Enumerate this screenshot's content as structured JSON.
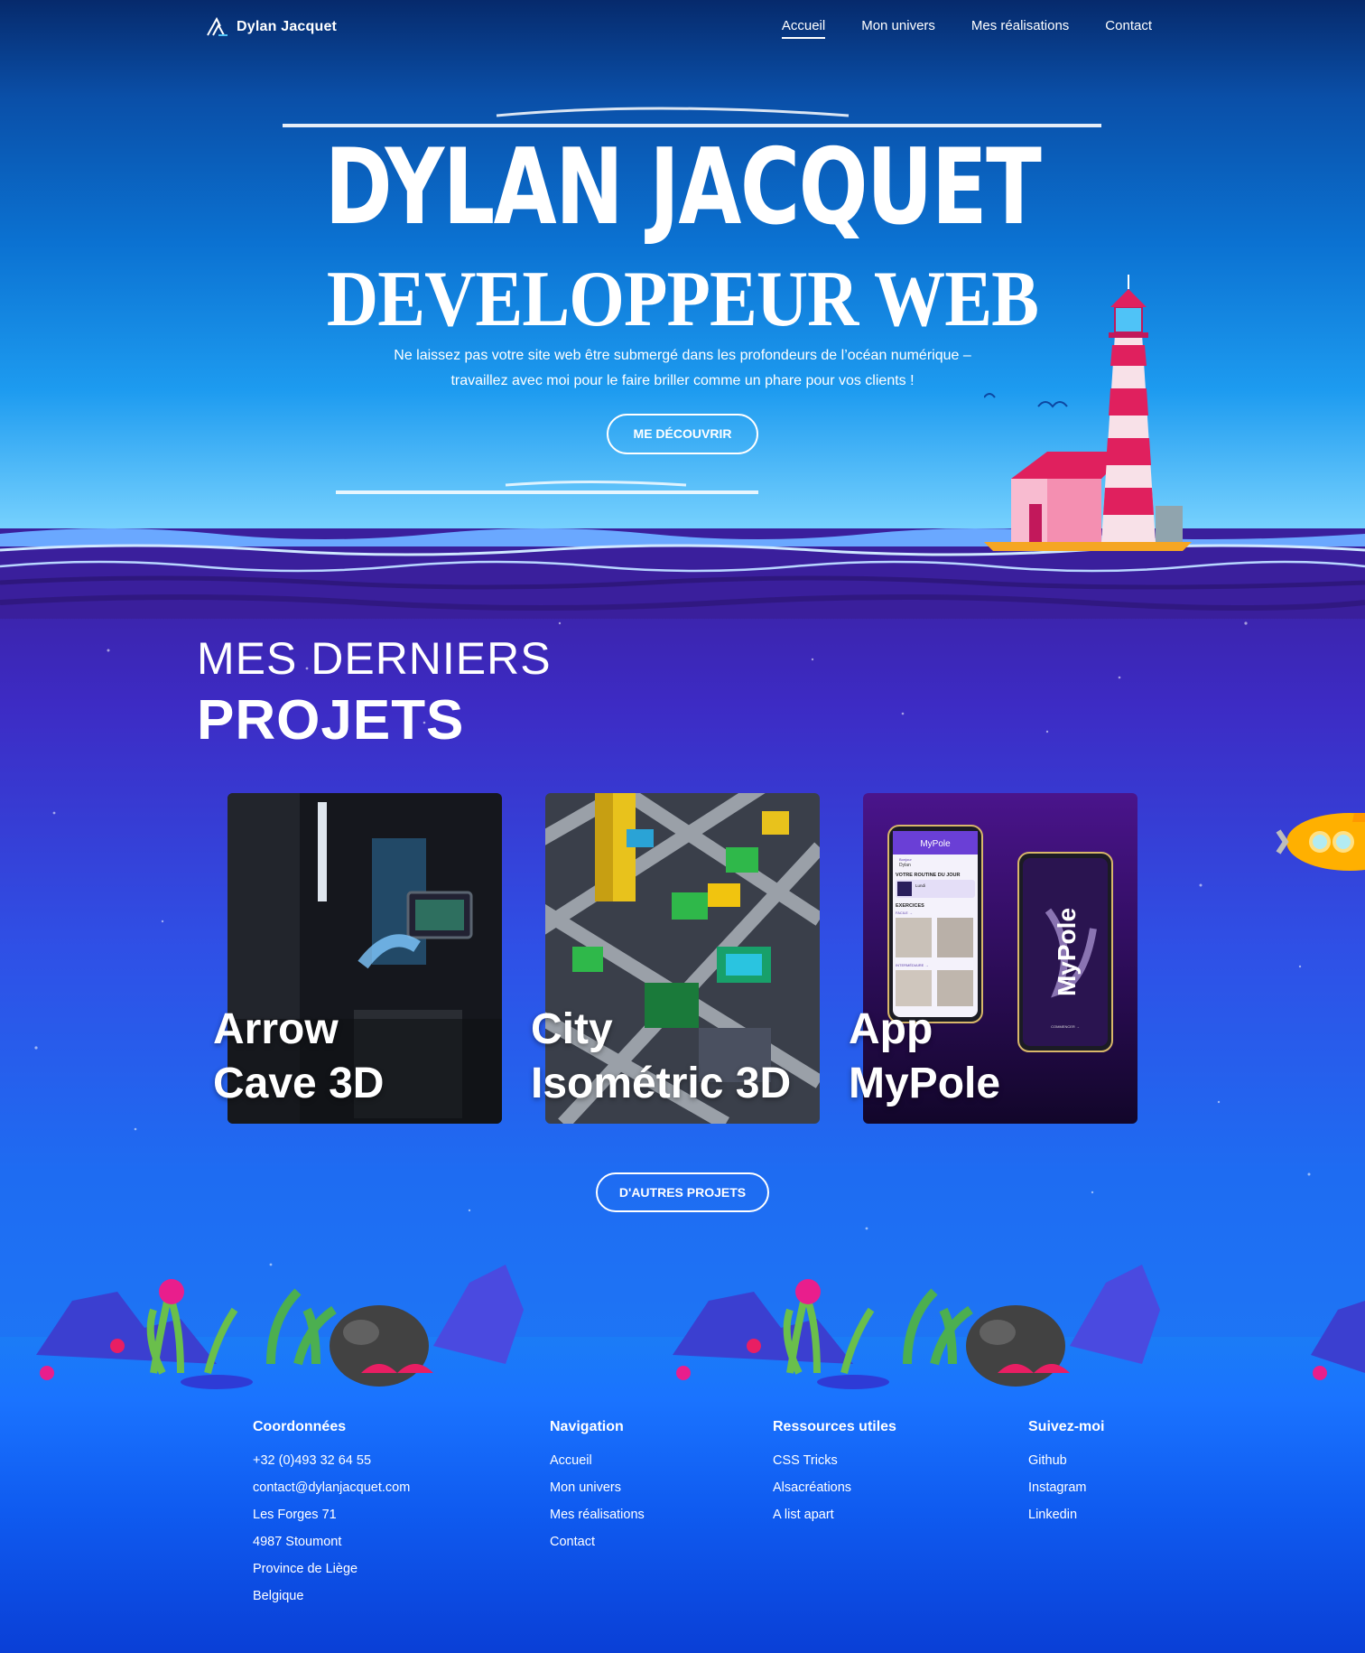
{
  "header": {
    "brand": "Dylan Jacquet",
    "nav": [
      "Accueil",
      "Mon univers",
      "Mes réalisations",
      "Contact"
    ],
    "active_nav": "Accueil"
  },
  "hero": {
    "title": "DYLAN JACQUET",
    "subtitle": "DEVELOPPEUR WEB",
    "text_line1": "Ne laissez pas votre site web être submergé dans les profondeurs de l’océan numérique –",
    "text_line2": "travaillez avec moi pour le faire briller comme un phare pour vos clients !",
    "cta": "ME DÉCOUVRIR"
  },
  "projects": {
    "kicker": "MES DERNIERS",
    "title": "PROJETS",
    "cards": [
      {
        "line1": "Arrow",
        "line2": "Cave 3D"
      },
      {
        "line1": "City",
        "line2": "Isométric 3D"
      },
      {
        "line1": "App",
        "line2": "MyPole"
      }
    ],
    "mockup": {
      "app_name": "MyPole",
      "greeting_small": "Bonjour",
      "greeting_name": "Dylan",
      "routine": "VOTRE ROUTINE DU JOUR",
      "routine_day": "Lundi",
      "exercises": "EXERCICES",
      "level_easy": "FACILE →",
      "level_mid": "INTERMÉDIAIRE →",
      "start": "COMMENCER →"
    },
    "more_cta": "D'AUTRES PROJETS"
  },
  "footer": {
    "contact": {
      "title": "Coordonnées",
      "lines": [
        "+32 (0)493 32 64 55",
        "contact@dylanjacquet.com",
        "Les Forges 71",
        "4987 Stoumont",
        "Province de Liège",
        "Belgique"
      ]
    },
    "navigation": {
      "title": "Navigation",
      "links": [
        "Accueil",
        "Mon univers",
        "Mes réalisations",
        "Contact"
      ]
    },
    "resources": {
      "title": "Ressources utiles",
      "links": [
        "CSS Tricks",
        "Alsacréations",
        "A list apart"
      ]
    },
    "social": {
      "title": "Suivez-moi",
      "links": [
        "Github",
        "Instagram",
        "Linkedin"
      ]
    }
  },
  "colors": {
    "sky_top": "#062a6c",
    "sea_purple": "#3a1f9c",
    "sea_blue": "#1d7af7",
    "lighthouse_red": "#e0205e",
    "submarine_yellow": "#ffb000"
  },
  "icons": [
    "brand-logo-icon",
    "lighthouse-illustration",
    "submarine-illustration",
    "seabed-reef-illustration"
  ]
}
